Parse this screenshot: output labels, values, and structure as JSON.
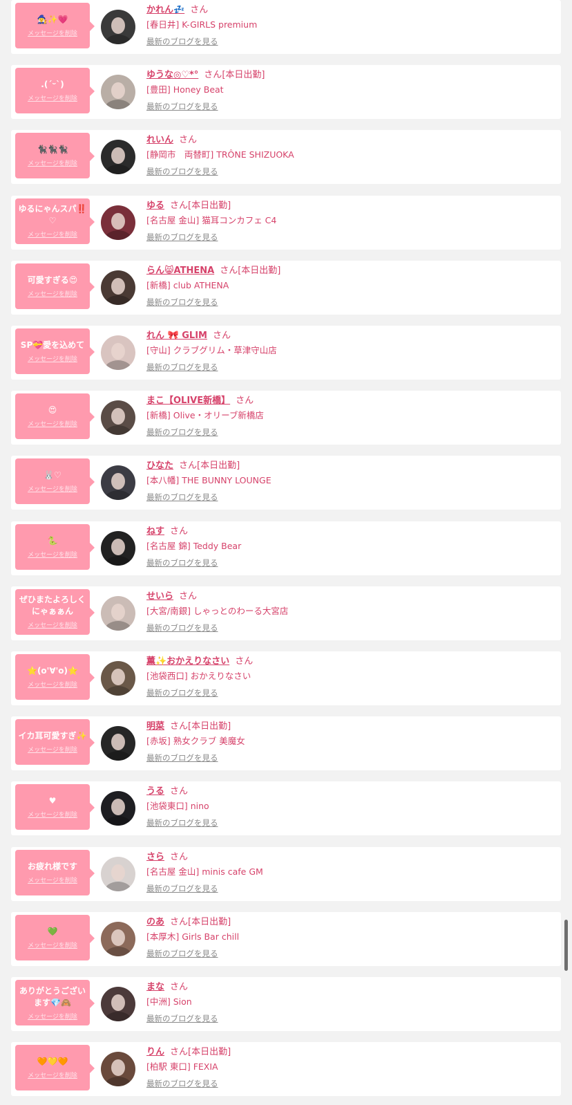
{
  "ui": {
    "san": "さん",
    "delete_label": "メッセージを削除",
    "blog_label": "最新のブログを見る",
    "working_today": "[本日出勤]"
  },
  "entries": [
    {
      "message": "🧙‍♀️✨💗",
      "name": "かれん💤",
      "working": false,
      "shop": "[春日井] K-GIRLS premium",
      "avatar_tone": "#3a3a3a"
    },
    {
      "message": ".(ˊᵕˋ)",
      "name": "ゆうな◎♡*°",
      "working": true,
      "shop": "[豊田] Honey Beat",
      "avatar_tone": "#b9aea6"
    },
    {
      "message": "🐈‍⬛🐈‍⬛🐈‍⬛",
      "name": "れいん",
      "working": false,
      "shop": "[静岡市　両替町] TRÔNE SHIZUOKA",
      "avatar_tone": "#2b2b2b"
    },
    {
      "message": "ゆるにゃんスパ‼️♡",
      "name": "ゆる",
      "working": true,
      "shop": "[名古屋 金山] 猫耳コンカフェ C4",
      "avatar_tone": "#7a2f3a"
    },
    {
      "message": "可愛すぎる😍",
      "name": "らん😸ATHENA",
      "working": true,
      "shop": "[新橋] club ATHENA",
      "avatar_tone": "#4a3a34"
    },
    {
      "message": "SP💝愛を込めて",
      "name": "れん 🎀 GLIM",
      "working": false,
      "shop": "[守山] クラブグリム・草津守山店",
      "avatar_tone": "#d9c4c0"
    },
    {
      "message": "😍",
      "name": "まこ【OLIVE新橋】",
      "working": false,
      "shop": "[新橋] Olive・オリーブ新橋店",
      "avatar_tone": "#5a4c46"
    },
    {
      "message": "🐰♡",
      "name": "ひなた",
      "working": true,
      "shop": "[本八幡] THE BUNNY LOUNGE",
      "avatar_tone": "#3c3c44"
    },
    {
      "message": "🐍",
      "name": "ねす",
      "working": false,
      "shop": "[名古屋 錦] Teddy Bear",
      "avatar_tone": "#222222"
    },
    {
      "message": "ぜひまたよろしくにゃぁぁん",
      "name": "せいら",
      "working": false,
      "shop": "[大宮/南銀] しゃっとのわーる大宮店",
      "avatar_tone": "#cbbcb6"
    },
    {
      "message": "⭐️(o'∀'o)⭐️",
      "name": "薫✨おかえりなさい",
      "working": false,
      "shop": "[池袋西口] おかえりなさい",
      "avatar_tone": "#6a5848"
    },
    {
      "message": "イカ耳可愛すぎ✨",
      "name": "明菜",
      "working": true,
      "shop": "[赤坂] 熟女クラブ 美魔女",
      "avatar_tone": "#262626"
    },
    {
      "message": "♥",
      "name": "うる",
      "working": false,
      "shop": "[池袋東口] nino",
      "avatar_tone": "#1e1e22"
    },
    {
      "message": "お疲れ様です",
      "name": "さら",
      "working": false,
      "shop": "[名古屋 金山] minis cafe GM",
      "avatar_tone": "#d8d2d0"
    },
    {
      "message": "💚",
      "name": "のあ",
      "working": true,
      "shop": "[本厚木] Girls Bar chill",
      "avatar_tone": "#8c6a5a"
    },
    {
      "message": "ありがとうございます💎🙈",
      "name": "まな",
      "working": false,
      "shop": "[中洲] Sion",
      "avatar_tone": "#4c3a3a"
    },
    {
      "message": "🧡💛🧡",
      "name": "りん",
      "working": true,
      "shop": "[柏駅 東口] FEXIA",
      "avatar_tone": "#6a4a3c"
    }
  ]
}
